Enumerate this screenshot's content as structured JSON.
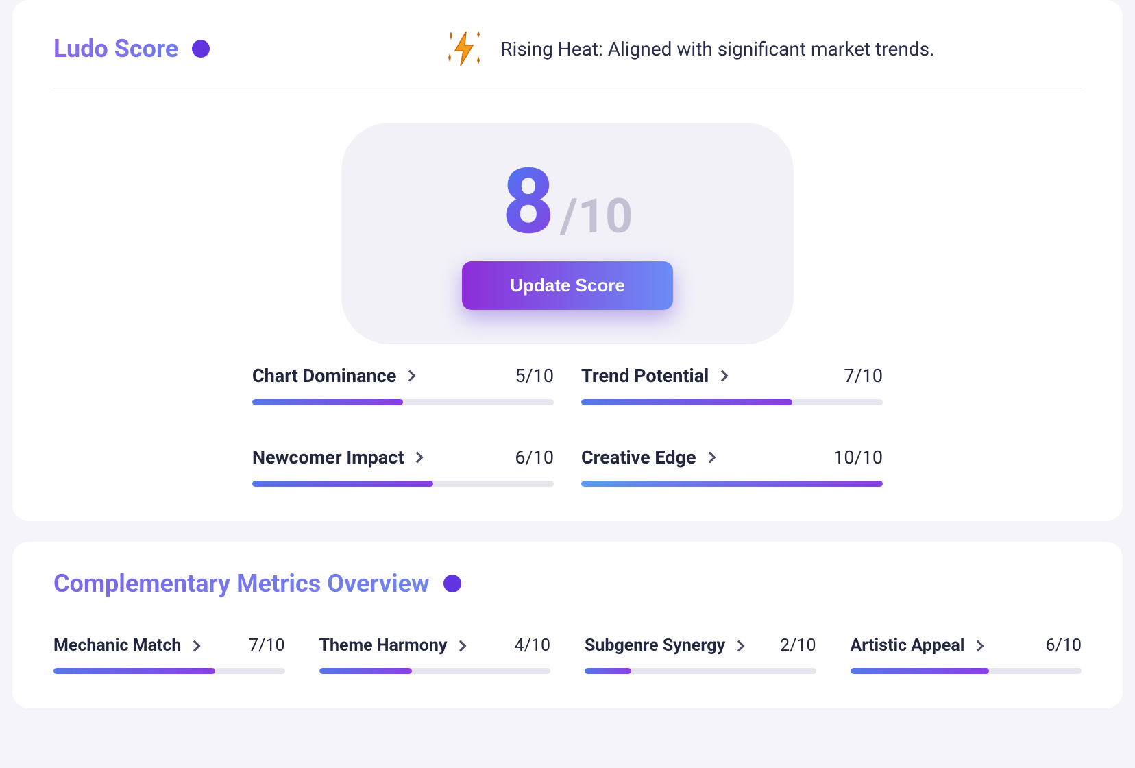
{
  "main": {
    "title": "Ludo Score",
    "trend_text": "Rising Heat: Aligned with significant market trends.",
    "score_value": "8",
    "score_denom": "/10",
    "update_button": "Update Score",
    "metrics": [
      {
        "label": "Chart Dominance",
        "value": "5/10",
        "pct": 50
      },
      {
        "label": "Trend Potential",
        "value": "7/10",
        "pct": 70
      },
      {
        "label": "Newcomer Impact",
        "value": "6/10",
        "pct": 60
      },
      {
        "label": "Creative Edge",
        "value": "10/10",
        "pct": 100
      }
    ]
  },
  "secondary": {
    "title": "Complementary Metrics Overview",
    "metrics": [
      {
        "label": "Mechanic Match",
        "value": "7/10",
        "pct": 70
      },
      {
        "label": "Theme Harmony",
        "value": "4/10",
        "pct": 40
      },
      {
        "label": "Subgenre Synergy",
        "value": "2/10",
        "pct": 20
      },
      {
        "label": "Artistic Appeal",
        "value": "6/10",
        "pct": 60
      }
    ]
  }
}
